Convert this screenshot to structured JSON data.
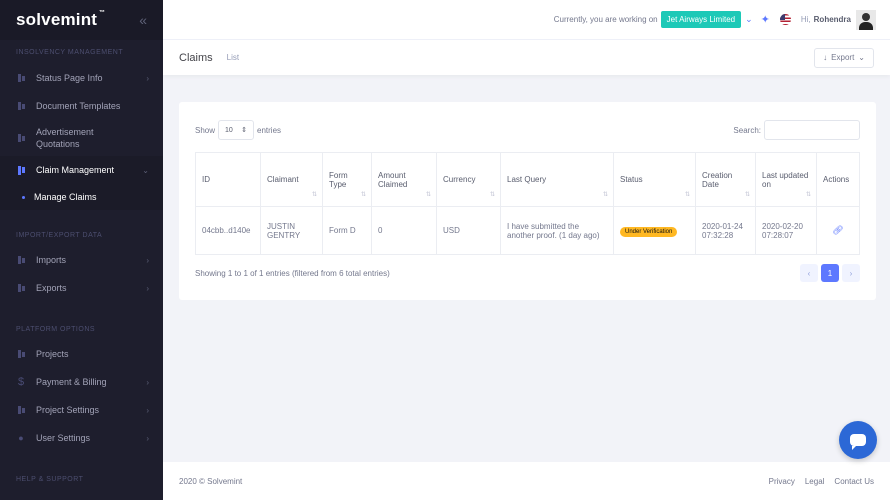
{
  "brand": {
    "name": "solvemint",
    "tm": "™"
  },
  "sidebar": {
    "sections": [
      {
        "label": "INSOLVENCY MANAGEMENT"
      },
      {
        "label": "IMPORT/EXPORT DATA"
      },
      {
        "label": "PLATFORM OPTIONS"
      },
      {
        "label": "HELP & SUPPORT"
      }
    ],
    "items": [
      {
        "label": "Status Page Info"
      },
      {
        "label": "Document Templates"
      },
      {
        "label": "Advertisement Quotations"
      },
      {
        "label": "Claim Management"
      },
      {
        "label": "Manage Claims"
      },
      {
        "label": "Imports"
      },
      {
        "label": "Exports"
      },
      {
        "label": "Projects"
      },
      {
        "label": "Payment & Billing"
      },
      {
        "label": "Project Settings"
      },
      {
        "label": "User Settings"
      }
    ]
  },
  "topbar": {
    "working_text": "Currently, you are working on",
    "company": "Jet Airways Limited",
    "greeting": "Hi,",
    "username": "Rohendra"
  },
  "subheader": {
    "title": "Claims",
    "crumb": "List",
    "export_label": "Export"
  },
  "table_controls": {
    "show_label": "Show",
    "entries_value": "10",
    "entries_label": "entries",
    "search_label": "Search:"
  },
  "table": {
    "columns": [
      "ID",
      "Claimant",
      "Form Type",
      "Amount Claimed",
      "Currency",
      "Last Query",
      "Status",
      "Creation Date",
      "Last updated on",
      "Actions"
    ],
    "rows": [
      {
        "id": "04cbb..d140e",
        "claimant": "JUSTIN GENTRY",
        "form_type": "Form D",
        "amount": "0",
        "currency": "USD",
        "last_query": "I have submitted the another proof. (1 day ago)",
        "status": "Under Verification",
        "created": "2020-01-24 07:32:28",
        "updated": "2020-02-20 07:28:07"
      }
    ]
  },
  "table_info": "Showing 1 to 1 of 1 entries (filtered from 6 total entries)",
  "pagination": {
    "prev": "‹",
    "current": "1",
    "next": "›"
  },
  "footer": {
    "copyright": "2020 © Solvemint",
    "links": [
      "Privacy",
      "Legal",
      "Contact Us"
    ]
  },
  "colors": {
    "accent": "#5d78ff",
    "company_badge": "#1dc9b7",
    "status_warning": "#ffb822",
    "sidebar_bg": "#1e1e2d"
  },
  "icons": {
    "chat": "chat-bubble-icon",
    "actions": "link-icon"
  }
}
